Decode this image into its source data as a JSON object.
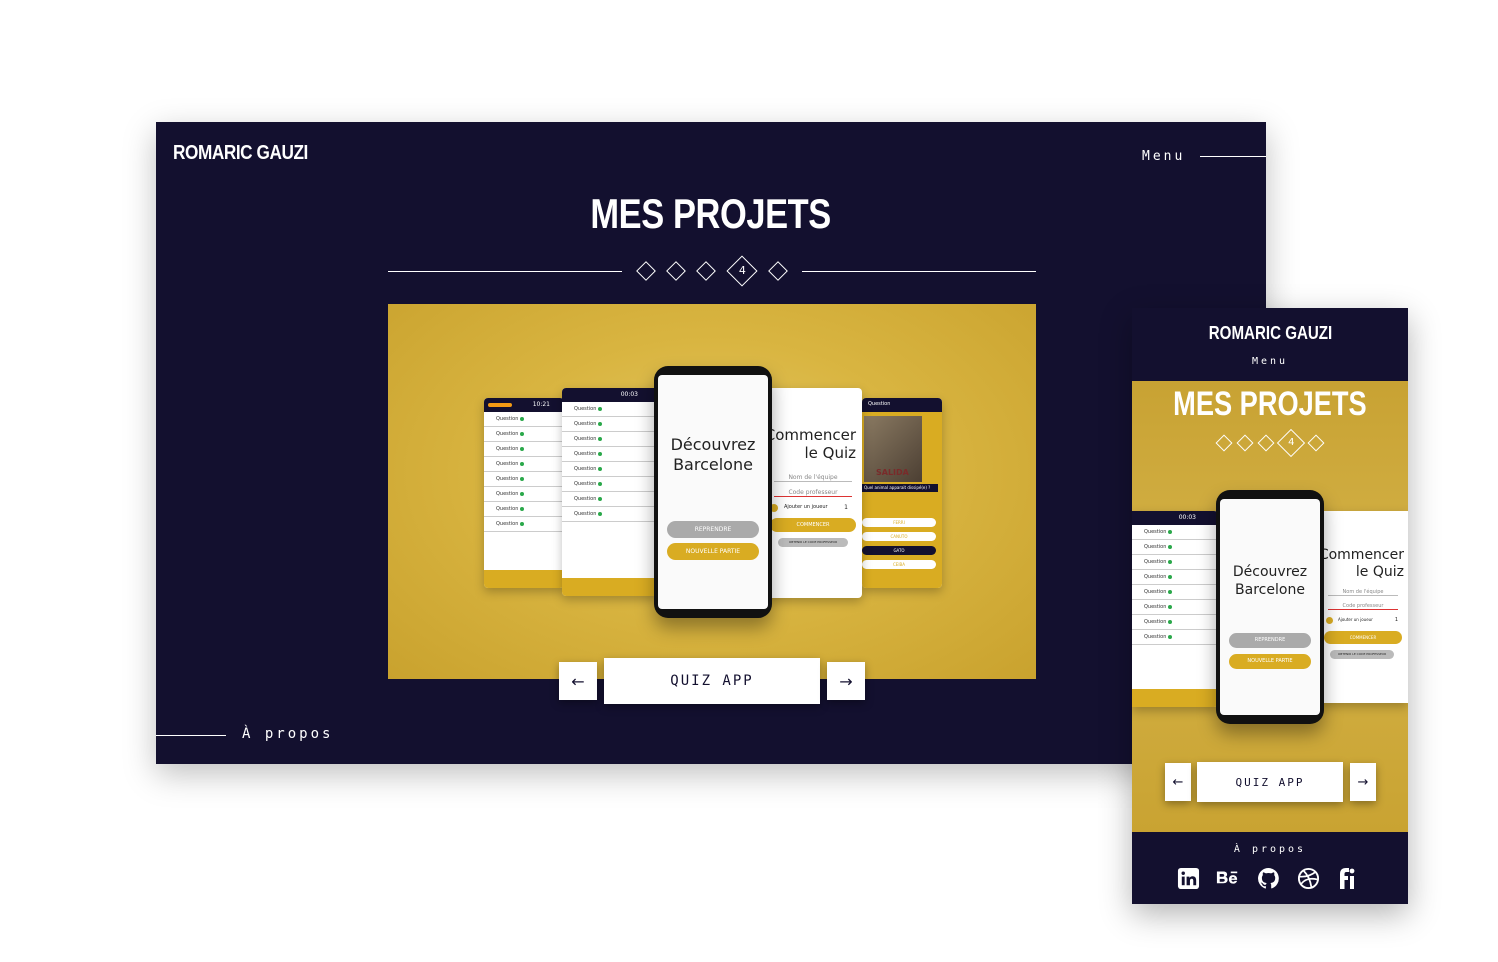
{
  "desktop": {
    "brand": "ROMARIC GAUZI",
    "menu_label": "Menu",
    "title": "MES PROJETS",
    "pager": {
      "current": "4"
    },
    "project": {
      "label": "QUIZ APP",
      "prev_icon": "←",
      "next_icon": "→"
    },
    "about_label": "À propos"
  },
  "mockup": {
    "headline": "Découvrez Barcelone",
    "btn_resume": "REPRENDRE",
    "btn_new": "NOUVELLE PARTIE",
    "quiz_title": "Commencer le Quiz",
    "team_placeholder": "Nom de l'équipe",
    "code_placeholder": "Code professeur",
    "add_player": "Ajouter un joueur",
    "player_count": "1",
    "start": "COMMENCER",
    "get_code": "OBTENIR LE CODE PROFESSEUR",
    "question_label": "Question",
    "time_a": "10:21",
    "time_b": "00:03",
    "answers": [
      "FERRI",
      "CANUTO",
      "GATO",
      "CEIBA"
    ],
    "picture_caption": "SALIDA",
    "picture_question": "Quel animal apparait dissipé(e) ?"
  },
  "mobile": {
    "brand": "ROMARIC GAUZI",
    "menu_label": "Menu",
    "title": "MES PROJETS",
    "pager": {
      "current": "4"
    },
    "project": {
      "label": "QUIZ APP",
      "prev_icon": "←",
      "next_icon": "→"
    },
    "about_label": "À propos",
    "socials": [
      "linkedin-icon",
      "behance-icon",
      "github-icon",
      "dribbble-icon",
      "freelance-icon"
    ]
  },
  "colors": {
    "navy": "#13102f",
    "gold": "#d9b541",
    "white": "#ffffff"
  }
}
